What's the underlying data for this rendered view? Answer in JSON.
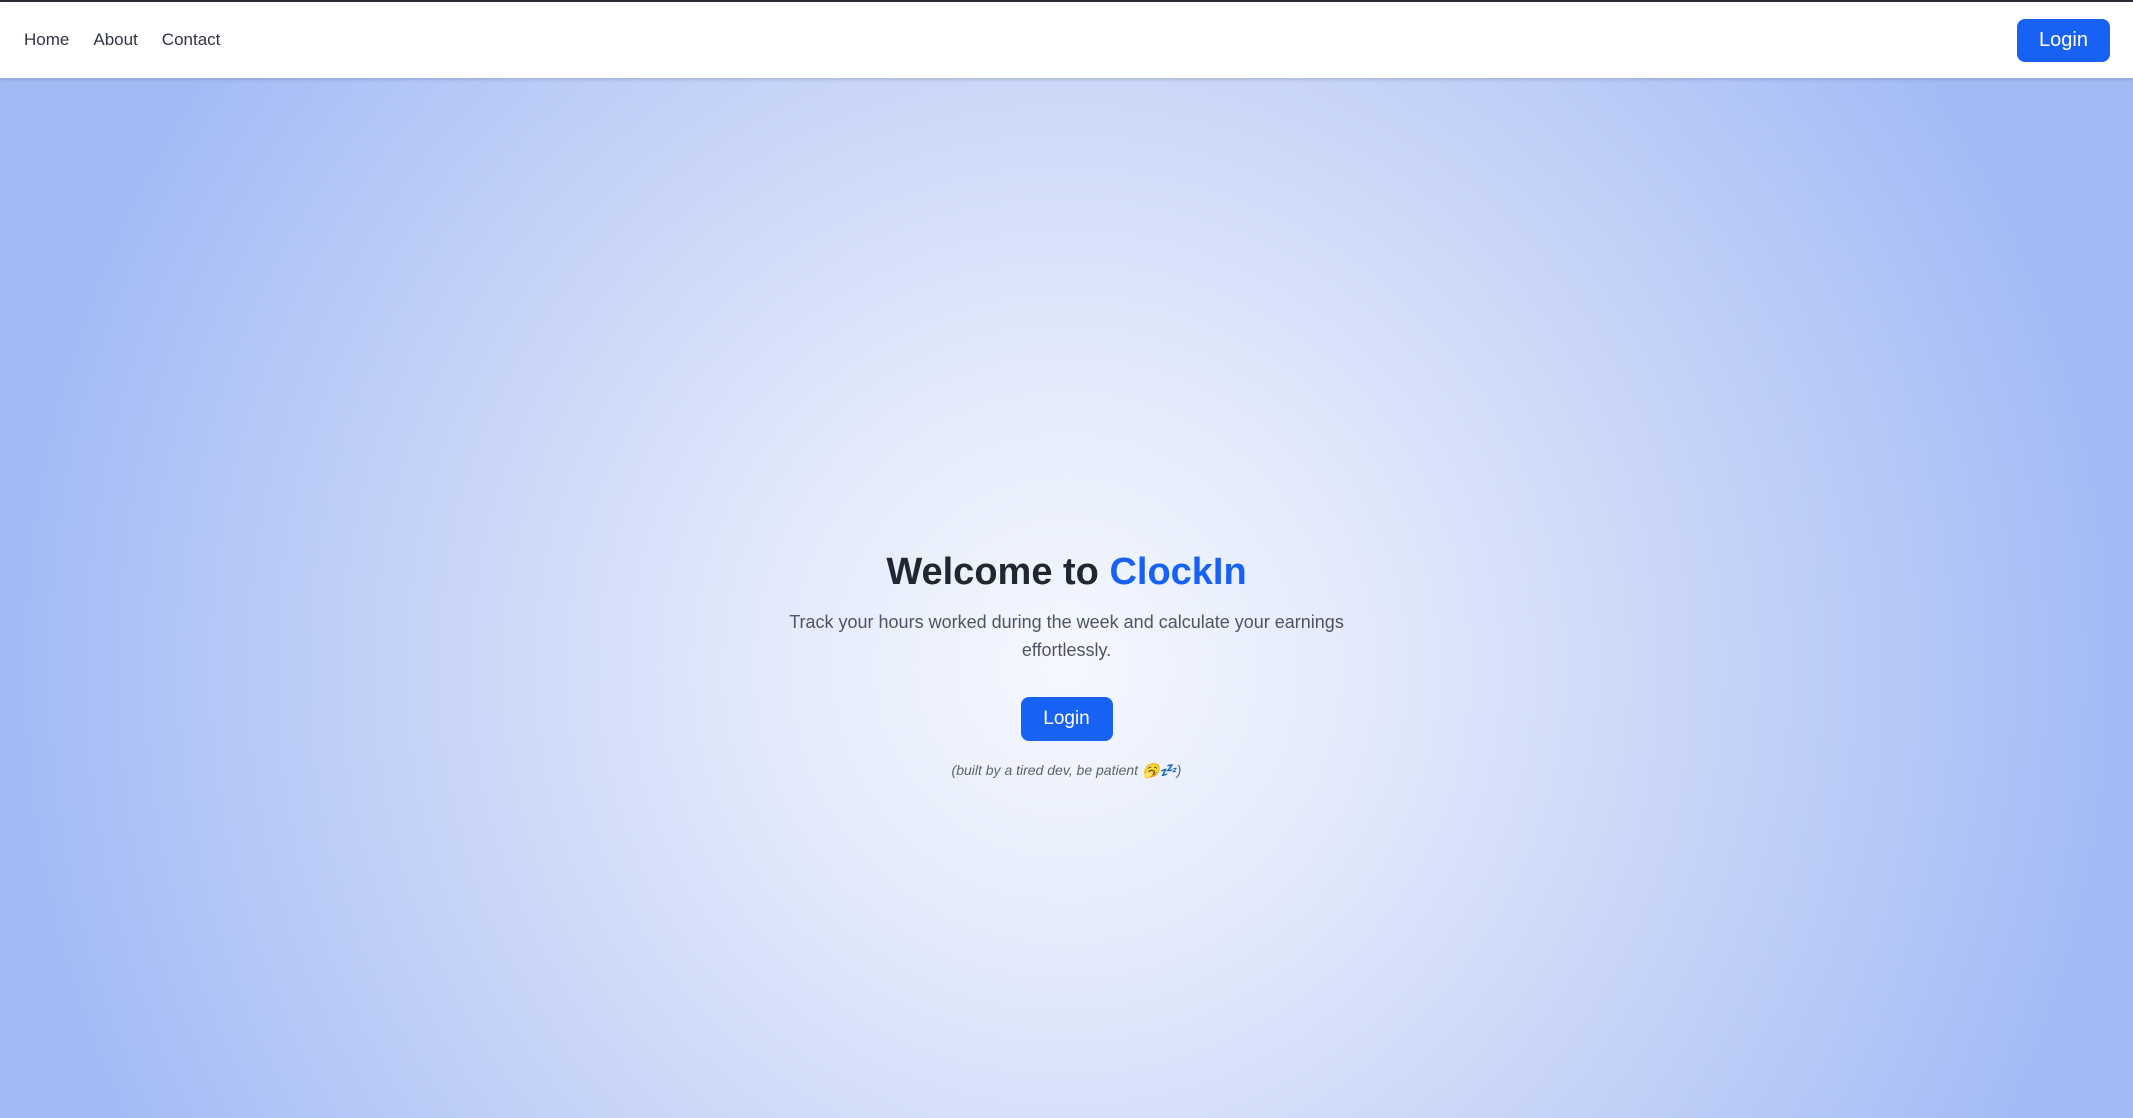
{
  "nav": {
    "links": [
      "Home",
      "About",
      "Contact"
    ],
    "login_label": "Login"
  },
  "hero": {
    "title_prefix": "Welcome to ",
    "title_brand": "ClockIn",
    "subtitle": "Track your hours worked during the week and calculate your earnings effortlessly.",
    "login_label": "Login",
    "note": "(built by a tired dev, be patient 🥱💤)"
  },
  "colors": {
    "accent": "#1861f5",
    "text_dark": "#1f2733",
    "text_muted": "#4d5563"
  }
}
